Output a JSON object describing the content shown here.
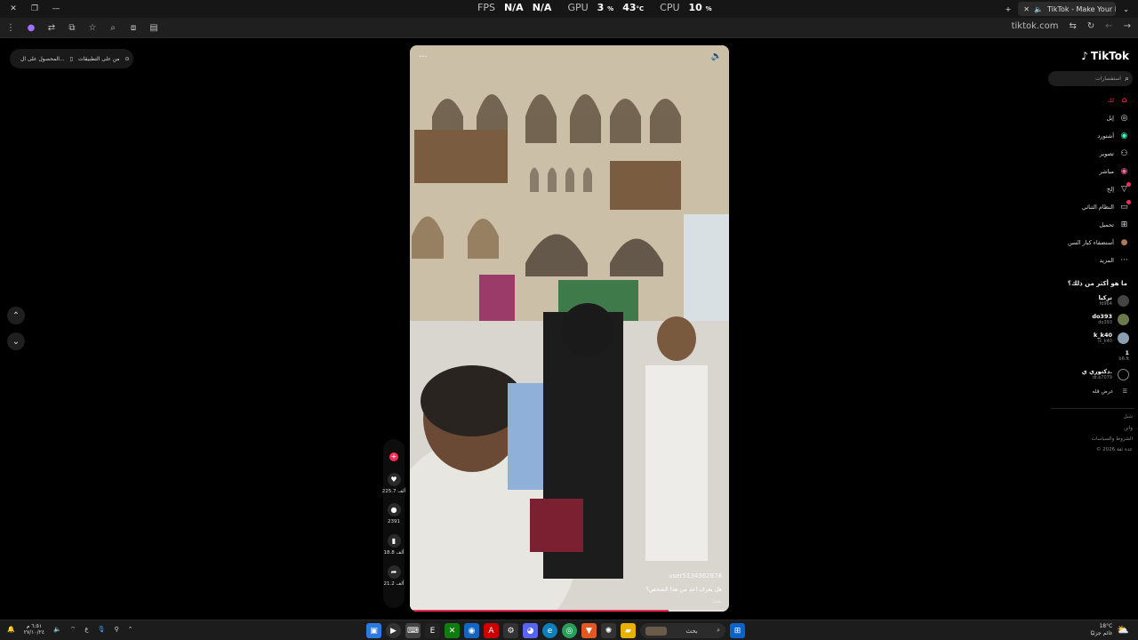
{
  "titlebar": {
    "close_label": "✕",
    "restore_label": "❐",
    "minimize_label": "—",
    "fps_label": "FPS",
    "fps_value1": "N/A",
    "fps_value2": "N/A",
    "gpu_label": "GPU",
    "gpu_value": "3",
    "gpu_unit": "%",
    "gpu_temp": "43",
    "gpu_temp_unit": "°C",
    "cpu_label": "CPU",
    "cpu_value": "10",
    "cpu_unit": "%",
    "tab_title": "TikTok - Make Your Day",
    "new_tab": "+",
    "tab_close": "✕",
    "tab_list": "⌄"
  },
  "addressbar": {
    "url": "tiktok.com"
  },
  "banner": {
    "get_app": "المحصول على ال...",
    "on_app": "من على التطبيقات"
  },
  "video": {
    "more": "···",
    "username": "user5134362678",
    "caption": "هل يعرف احد من هذا الشخص؟",
    "more_label": "بحث",
    "progress": 0.81
  },
  "actions": {
    "likes": "225.7 ألف",
    "comments": "2391",
    "saves": "18.8 ألف",
    "shares": "21.2 ألف"
  },
  "sidebar": {
    "brand": "TikTok",
    "search_placeholder": "استفسارات",
    "nav": [
      {
        "label": "لك",
        "icon": "home-icon"
      },
      {
        "label": "إبل",
        "icon": "compass-icon"
      },
      {
        "label": "أشتورد",
        "icon": "profile-icon"
      },
      {
        "label": "تصوير",
        "icon": "friends-icon"
      },
      {
        "label": "مباشر",
        "icon": "live-icon"
      },
      {
        "label": "إلخ",
        "icon": "activity-icon"
      },
      {
        "label": "النظام الثنائي",
        "icon": "messages-icon"
      },
      {
        "label": "تحميل",
        "icon": "upload-icon"
      },
      {
        "label": "أستضفاء كبار السن",
        "icon": "avatar-icon"
      },
      {
        "label": "المزيد",
        "icon": "more-icon"
      }
    ],
    "following_title": "ما هو أكثر من ذلك؟",
    "accounts": [
      {
        "name": "تركيا",
        "handle": "fd964"
      },
      {
        "name": "do393",
        "handle": "do393"
      },
      {
        "name": "k_k40",
        "handle": "ic_k40"
      },
      {
        "name": "1",
        "handle": "b6.ft"
      },
      {
        "name": "دكتوري ي.",
        "handle": "dr.e7079"
      }
    ],
    "see_more": "عرض قله",
    "footer": [
      "شبل",
      "واتن",
      "الشروط والسياسات",
      "© 2026 عدة ثقة"
    ]
  },
  "taskbar": {
    "clock_time": "٦:٥١ م",
    "clock_date": "٢٧/١٠/٢٤",
    "weather_temp": "18°C",
    "weather_text": "غائم جزئيًا",
    "search_label": "بحث",
    "lang": "ع"
  }
}
